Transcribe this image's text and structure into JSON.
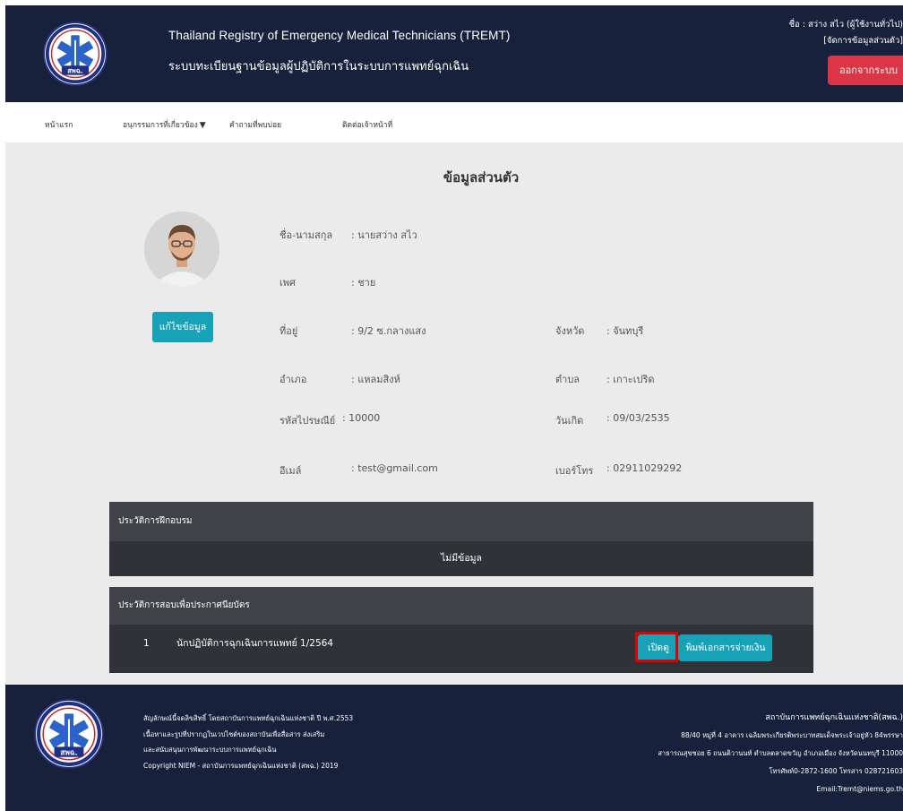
{
  "header": {
    "title_en": "Thailand Registry of Emergency Medical Technicians (TREMT)",
    "title_th": "ระบบทะเบียนฐานข้อมูลผู้ปฏิบัติการในระบบการแพทย์ฉุกเฉิน",
    "user_label": "ชื่อ : สว่าง สไว (ผู้ใช้งานทั่วไป)",
    "manage_link": "[จัดการข้อมูลส่วนตัว]",
    "logout_label": "ออกจากระบบ",
    "logo_text": "สพฉ."
  },
  "nav": {
    "home": "หน้าแรก",
    "courses": "อนุกรรมการที่เกี่ยวข้อง",
    "faq": "คำถามที่พบบ่อย",
    "contact": "ติดต่อเจ้าหน้าที่"
  },
  "profile": {
    "page_title": "ข้อมูลส่วนตัว",
    "edit_button": "แก้ไขข้อมูล",
    "name_label": "ชื่อ-นามสกุล",
    "name_value": ": นายสว่าง สไว",
    "gender_label": "เพศ",
    "gender_value": ": ชาย",
    "address_label": "ที่อยู่",
    "address_value": ": 9/2 ซ.กลางแสง",
    "province_label": "จังหวัด",
    "province_value": ": จันทบุรี",
    "district_label": "อำเภอ",
    "district_value": ": แหลมสิงห์",
    "subdistrict_label": "ตำบล",
    "subdistrict_value": ": เกาะเปริด",
    "postcode_label": "รหัสไปรษณีย์",
    "postcode_value": ": 10000",
    "birthdate_label": "วันเกิด",
    "birthdate_value": ": 09/03/2535",
    "email_label": "อีเมล์",
    "email_value": ": test@gmail.com",
    "phone_label": "เบอร์โทร",
    "phone_value": ": 02911029292"
  },
  "training": {
    "heading": "ประวัติการฝึกอบรม",
    "empty": "ไม่มีข้อมูล"
  },
  "exams": {
    "heading": "ประวัติการสอบเพื่อประกาศนียบัตร",
    "rows": [
      {
        "no": "1",
        "name": "นักปฏิบัติการฉุกเฉินการแพทย์ 1/2564",
        "view_label": "เปิดดู",
        "print_label": "พิมพ์เอกสารจ่ายเงิน"
      }
    ]
  },
  "footer": {
    "left_lines": [
      "สัญลักษณ์นี้จดลิขสิทธิ์ โดยสถาบันการแพทย์ฉุกเฉินแห่งชาติ ปี พ.ศ.2553",
      "เนื้อหาและรูปที่ปรากฏในเวปไซต์ของสถาบันเพื่อสื่อสาร ส่งเสริม",
      "และสนับสนุนการพัฒนาระบบการแพทย์ฉุกเฉิน",
      "Copyright NIEM - สถาบันการแพทย์ฉุกเฉินแห่งชาติ (สพฉ.) 2019"
    ],
    "org_name": "สถาบันการแพทย์ฉุกเฉินแห่งชาติ(สพฉ.)",
    "address_1": "88/40 หมู่ที่ 4 อาคาร เฉลิมพระเกียรติพระบาทสมเด็จพระเจ้าอยู่หัว 84พรรษา",
    "address_2": "สาธารณสุขซอย 6 ถนนติวานนท์ ตำบลตลาดขวัญ อำเภอเมือง จังหวัดนนทบุรี 11000",
    "phone": "โทรศัพท์0-2872-1600 โทรสาร 028721603",
    "email": "Email:Tremt@niems.go.th"
  },
  "colors": {
    "header_bg": "#18213b",
    "accent": "#17a2b8",
    "danger": "#dc3545",
    "highlight": "#e10000"
  }
}
